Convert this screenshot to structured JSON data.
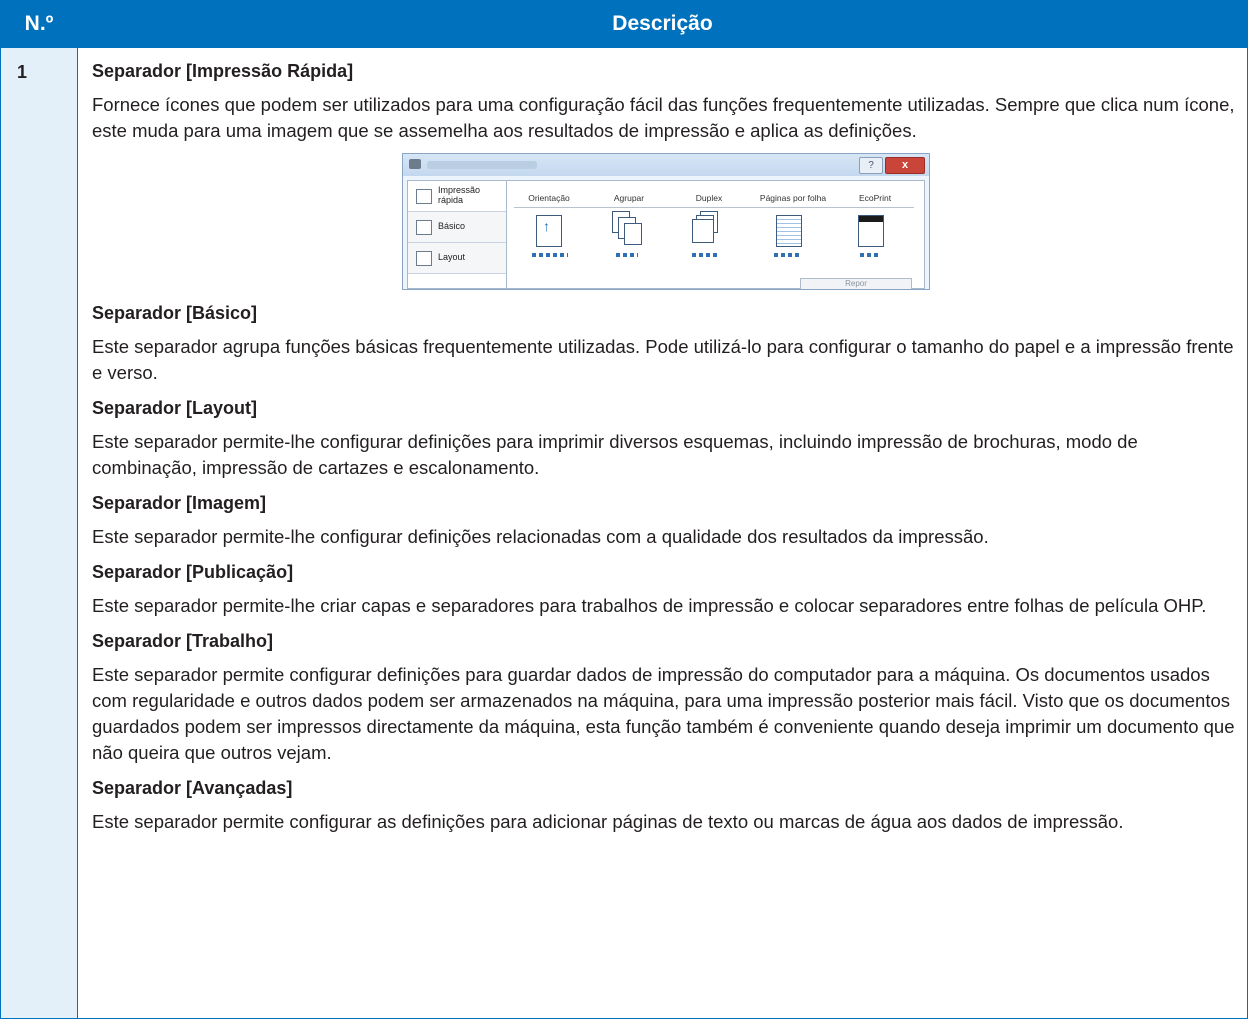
{
  "table": {
    "header_no": "N.º",
    "header_desc": "Descrição",
    "row_no": "1"
  },
  "sections": [
    {
      "title": "Separador [Impressão Rápida]",
      "text": "Fornece ícones que podem ser utilizados para uma configuração fácil das funções frequentemente utilizadas. Sempre que clica num ícone, este muda para uma imagem que se assemelha aos resultados de impressão e aplica as definições."
    },
    {
      "title": "Separador [Básico]",
      "text": "Este separador agrupa funções básicas frequentemente utilizadas. Pode utilizá-lo para configurar o tamanho do papel e a impressão frente e verso."
    },
    {
      "title": "Separador [Layout]",
      "text": "Este separador permite-lhe configurar definições para imprimir diversos esquemas, incluindo impressão de brochuras, modo de combinação, impressão de cartazes e escalonamento."
    },
    {
      "title": "Separador [Imagem]",
      "text": "Este separador permite-lhe configurar definições relacionadas com a qualidade dos resultados da impressão."
    },
    {
      "title": "Separador [Publicação]",
      "text": "Este separador permite-lhe criar capas e separadores para trabalhos de impressão e colocar separadores entre folhas de película OHP."
    },
    {
      "title": "Separador [Trabalho]",
      "text": "Este separador permite configurar definições para guardar dados de impressão do computador para a máquina. Os documentos usados com regularidade e outros dados podem ser armazenados na máquina, para uma impressão posterior mais fácil. Visto que os documentos guardados podem ser impressos directamente da máquina, esta função também é conveniente quando deseja imprimir um documento que não queira que outros vejam."
    },
    {
      "title": "Separador [Avançadas]",
      "text": "Este separador permite configurar as definições para adicionar páginas de texto ou marcas de água aos dados de impressão."
    }
  ],
  "dialog": {
    "help_label": "?",
    "close_label": "x",
    "tabs": [
      "Impressão rápida",
      "Básico",
      "Layout"
    ],
    "columns": [
      "Orientação",
      "Agrupar",
      "Duplex",
      "Páginas por folha",
      "EcoPrint"
    ],
    "reset_label": "Repor",
    "icons": [
      "printer-icon",
      "arrow-up-icon",
      "collate-icon",
      "duplex-icon",
      "pages-per-sheet-icon",
      "ecoprint-icon"
    ]
  },
  "colors": {
    "header_bg": "#0071bc",
    "number_cell_bg": "#e3f0fa",
    "text": "#231f20"
  }
}
